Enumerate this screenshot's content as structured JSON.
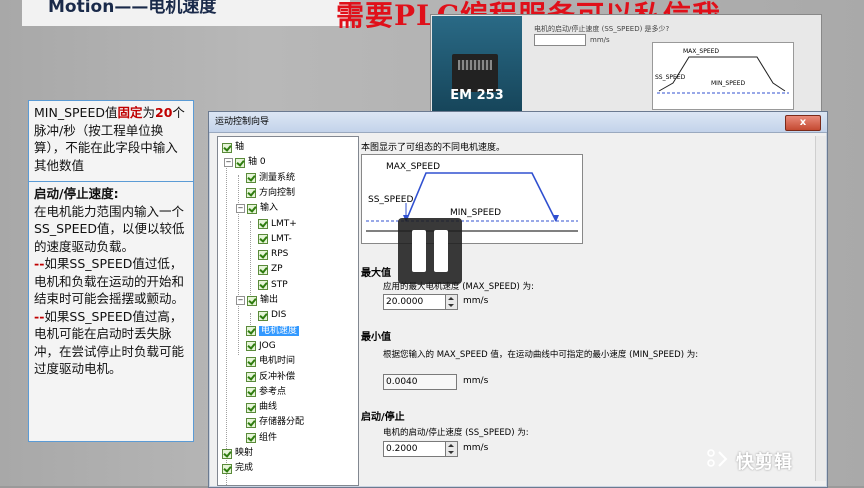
{
  "slide": {
    "title": "Motion——电机速度",
    "watermark_top": "需要PLC编程服务可以私信我"
  },
  "background_screenshot": {
    "device_label": "EM 253",
    "prompt_text": "电机的启动/停止速度 (SS_SPEED) 是多少?",
    "unit": "mm/s",
    "diagram_labels": [
      "MAX_SPEED",
      "SS_SPEED",
      "MIN_SPEED"
    ]
  },
  "note": {
    "box1_pre": "MIN_SPEED值",
    "box1_red": "固定",
    "box1_mid": "为",
    "box1_red2": "20",
    "box1_post": "个脉冲/秒（按工程单位换算），不能在此字段中输入其他数值",
    "heading": "启动/停止速度:",
    "p1": "在电机能力范围内输入一个SS_SPEED值，以便以较低的速度驱动负载。",
    "p2_dash": "--",
    "p2": "如果SS_SPEED值过低，电机和负载在运动的开始和结束时可能会摇摆或颤动。",
    "p3_dash": "--",
    "p3": "如果SS_SPEED值过高，电机可能在启动时丢失脉冲，在尝试停止时负载可能过度驱动电机。"
  },
  "wizard": {
    "title": "运动控制向导",
    "close_label": "x",
    "tree": [
      {
        "label": "轴",
        "selected": false
      },
      {
        "label": "轴 0",
        "selected": false
      },
      {
        "label": "测量系统",
        "selected": false
      },
      {
        "label": "方向控制",
        "selected": false
      },
      {
        "label": "输入",
        "selected": false
      },
      {
        "label": "LMT+",
        "selected": false
      },
      {
        "label": "LMT-",
        "selected": false
      },
      {
        "label": "RPS",
        "selected": false
      },
      {
        "label": "ZP",
        "selected": false
      },
      {
        "label": "STP",
        "selected": false
      },
      {
        "label": "输出",
        "selected": false
      },
      {
        "label": "DIS",
        "selected": false
      },
      {
        "label": "电机速度",
        "selected": true
      },
      {
        "label": "JOG",
        "selected": false
      },
      {
        "label": "电机时间",
        "selected": false
      },
      {
        "label": "反冲补偿",
        "selected": false
      },
      {
        "label": "参考点",
        "selected": false
      },
      {
        "label": "曲线",
        "selected": false
      },
      {
        "label": "存储器分配",
        "selected": false
      },
      {
        "label": "组件",
        "selected": false
      },
      {
        "label": "映射",
        "selected": false
      },
      {
        "label": "完成",
        "selected": false
      }
    ],
    "description": "本图显示了可组态的不同电机速度。",
    "diagram_labels": {
      "max": "MAX_SPEED",
      "ss": "SS_SPEED",
      "min": "MIN_SPEED"
    },
    "max": {
      "title": "最大值",
      "prompt": "应用的最大电机速度 (MAX_SPEED) 为:",
      "value": "20.0000",
      "unit": "mm/s"
    },
    "min": {
      "title": "最小值",
      "prompt": "根据您输入的 MAX_SPEED 值，在运动曲线中可指定的最小速度 (MIN_SPEED) 为:",
      "value": "0.0040",
      "unit": "mm/s"
    },
    "ss": {
      "title": "启动/停止",
      "prompt": "电机的启动/停止速度 (SS_SPEED) 为:",
      "value": "0.2000",
      "unit": "mm/s"
    }
  },
  "watermark_bottom": {
    "text": "快剪辑"
  },
  "colors": {
    "accent_red": "#e0101a",
    "note_border": "#5b9bd5",
    "diagram_blue": "#3050d0",
    "selection": "#3399ff"
  },
  "icons": [
    "pause-icon",
    "checkbox-checked-icon",
    "tree-expander-icon",
    "spinner-icon",
    "close-icon",
    "kuaijianji-logo-icon"
  ]
}
